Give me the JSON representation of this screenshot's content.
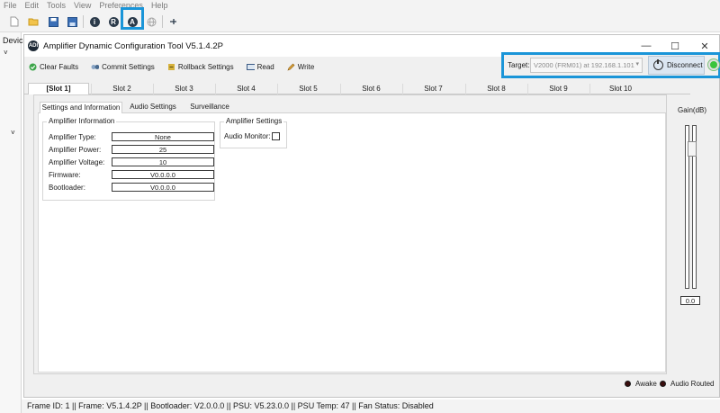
{
  "menubar": {
    "items": [
      "File",
      "Edit",
      "Tools",
      "View",
      "Preferences",
      "Help"
    ]
  },
  "toolbar": {
    "icons": [
      "new-file-icon",
      "open-folder-icon",
      "save-icon",
      "save-as-icon",
      "info-icon",
      "r-icon",
      "a-icon",
      "globe-icon",
      "pin-icon"
    ]
  },
  "left_panel": {
    "label": "Devic",
    "chevron": "˅",
    "chevron2": "˅"
  },
  "window": {
    "logo": "ADI",
    "title": "Amplifier Dynamic Configuration Tool V5.1.4.2P",
    "controls": {
      "minimize": "—",
      "maximize": "☐",
      "close": "✕"
    }
  },
  "commands": {
    "clear_faults": "Clear Faults",
    "commit_settings": "Commit Settings",
    "rollback_settings": "Rollback Settings",
    "read": "Read",
    "write": "Write"
  },
  "target": {
    "label": "Target:",
    "value": "V2000 (FRM01) at 192.168.1.101",
    "disconnect": "Disconnect",
    "status_color": "#3ac43a"
  },
  "slots": [
    "[Slot 1]",
    "Slot 2",
    "Slot 3",
    "Slot 4",
    "Slot 5",
    "Slot 6",
    "Slot 7",
    "Slot 8",
    "Slot 9",
    "Slot 10"
  ],
  "subtabs": [
    "Settings and Information",
    "Audio Settings",
    "Surveillance"
  ],
  "amp_info": {
    "title": "Amplifier Information",
    "rows": [
      {
        "label": "Amplifier Type:",
        "value": "None"
      },
      {
        "label": "Amplifier Power:",
        "value": "25"
      },
      {
        "label": "Amplifier Voltage:",
        "value": "10"
      },
      {
        "label": "Firmware:",
        "value": "V0.0.0.0"
      },
      {
        "label": "Bootloader:",
        "value": "V0.0.0.0"
      }
    ]
  },
  "amp_settings": {
    "title": "Amplifier Settings",
    "audio_monitor_label": "Audio Monitor:",
    "audio_monitor_checked": false
  },
  "gain": {
    "label": "Gain(dB)",
    "value": "0.0"
  },
  "indicators": {
    "awake": "Awake",
    "audio_routed": "Audio Routed"
  },
  "statusbar": {
    "text": "Frame ID: 1 || Frame: V5.1.4.2P || Bootloader: V2.0.0.0 || PSU: V5.23.0.0 || PSU Temp: 47 || Fan Status: Disabled"
  }
}
